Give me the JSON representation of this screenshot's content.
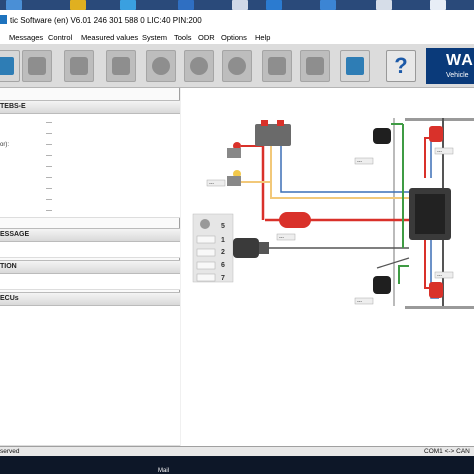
{
  "window": {
    "title": "tic Software (en) V6.01  246 301 588 0  LIC:40 PIN:200"
  },
  "menu": [
    "Messages",
    "Control",
    "Measured values",
    "System",
    "Tools",
    "ODR",
    "Options",
    "Help"
  ],
  "toolbar": {
    "help_label": "?",
    "brand_name": "WA",
    "brand_sub": "Vehicle",
    "icons": [
      "monitor-icon",
      "diagnosis-truck-icon",
      "ecu-trailer-icon",
      "trailer-icon",
      "tools-icon",
      "measure-disc-icon",
      "brake-wheel-icon",
      "settings-up-down-icon",
      "calibrate-icon",
      "network-icon",
      "ecu-gear-icon"
    ]
  },
  "left_panel": {
    "system_header": "TEBS-E",
    "params": [
      {
        "label": "",
        "value": "---"
      },
      {
        "label": "",
        "value": "---"
      },
      {
        "label": "or):",
        "value": "---"
      },
      {
        "label": "",
        "value": "---"
      },
      {
        "label": "",
        "value": "---"
      },
      {
        "label": "",
        "value": "---"
      },
      {
        "label": "",
        "value": "---"
      },
      {
        "label": "",
        "value": "---"
      },
      {
        "label": "",
        "value": "---"
      }
    ],
    "message_header": "ESSAGE",
    "info_header": "TION",
    "ecus_header": " ECUs"
  },
  "diagram": {
    "dash": "---",
    "port_labels": [
      "5",
      "1",
      "2",
      "6",
      "7"
    ],
    "colors": {
      "red_line": "#d9312a",
      "yellow_line": "#f2c879",
      "blue_line": "#3b6fb5",
      "green_line": "#3f9b44",
      "cable": "#555555",
      "ecu": "#3a3a3a"
    }
  },
  "status": {
    "left": "served",
    "right": "COM1 <-> CAN"
  },
  "taskbar": {
    "mail_label": "Mail"
  }
}
